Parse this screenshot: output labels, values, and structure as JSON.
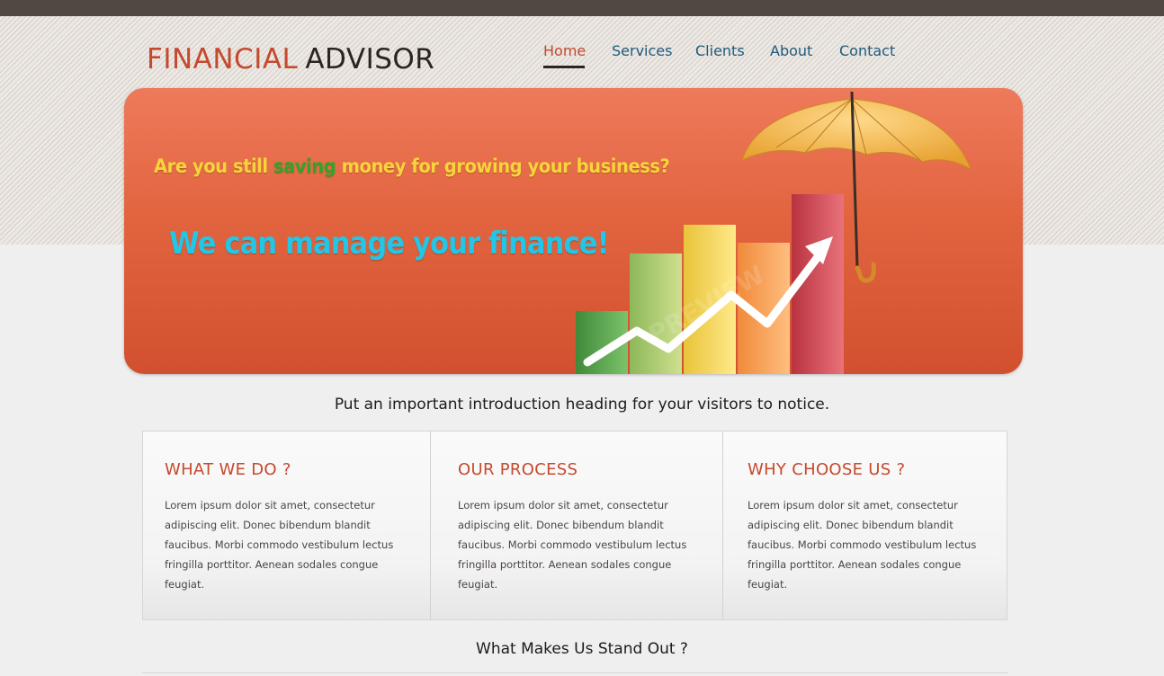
{
  "logo": {
    "part1": "FINANCIAL",
    "part2": "ADVISOR"
  },
  "nav": [
    {
      "label": "Home",
      "active": true
    },
    {
      "label": "Services"
    },
    {
      "label": "Clients"
    },
    {
      "label": "About"
    },
    {
      "label": "Contact"
    }
  ],
  "hero": {
    "line1_before": "Are you still ",
    "line1_highlight": "saving",
    "line1_after": " money for growing your business?",
    "line2": "We can manage your finance!",
    "watermark": "PREVIEW"
  },
  "intro_heading": "Put an important introduction heading for your visitors to notice.",
  "cards": [
    {
      "title": "WHAT WE DO ?",
      "text": "Lorem ipsum dolor sit amet, consectetur adipiscing elit. Donec bibendum blandit faucibus. Morbi commodo vestibulum lectus fringilla porttitor. Aenean sodales congue feugiat."
    },
    {
      "title": "OUR PROCESS",
      "text": "Lorem ipsum dolor sit amet, consectetur adipiscing elit. Donec bibendum blandit faucibus. Morbi commodo vestibulum lectus fringilla porttitor. Aenean sodales congue feugiat."
    },
    {
      "title": "WHY CHOOSE US ?",
      "text": "Lorem ipsum dolor sit amet, consectetur adipiscing elit. Donec bibendum blandit faucibus. Morbi commodo vestibulum lectus fringilla porttitor. Aenean sodales congue feugiat."
    }
  ],
  "stand_out_heading": "What Makes Us Stand Out ?",
  "colors": {
    "accent": "#c44a2e",
    "nav": "#1e5a7d",
    "hero": "#e2643f",
    "topbar": "#524843"
  }
}
